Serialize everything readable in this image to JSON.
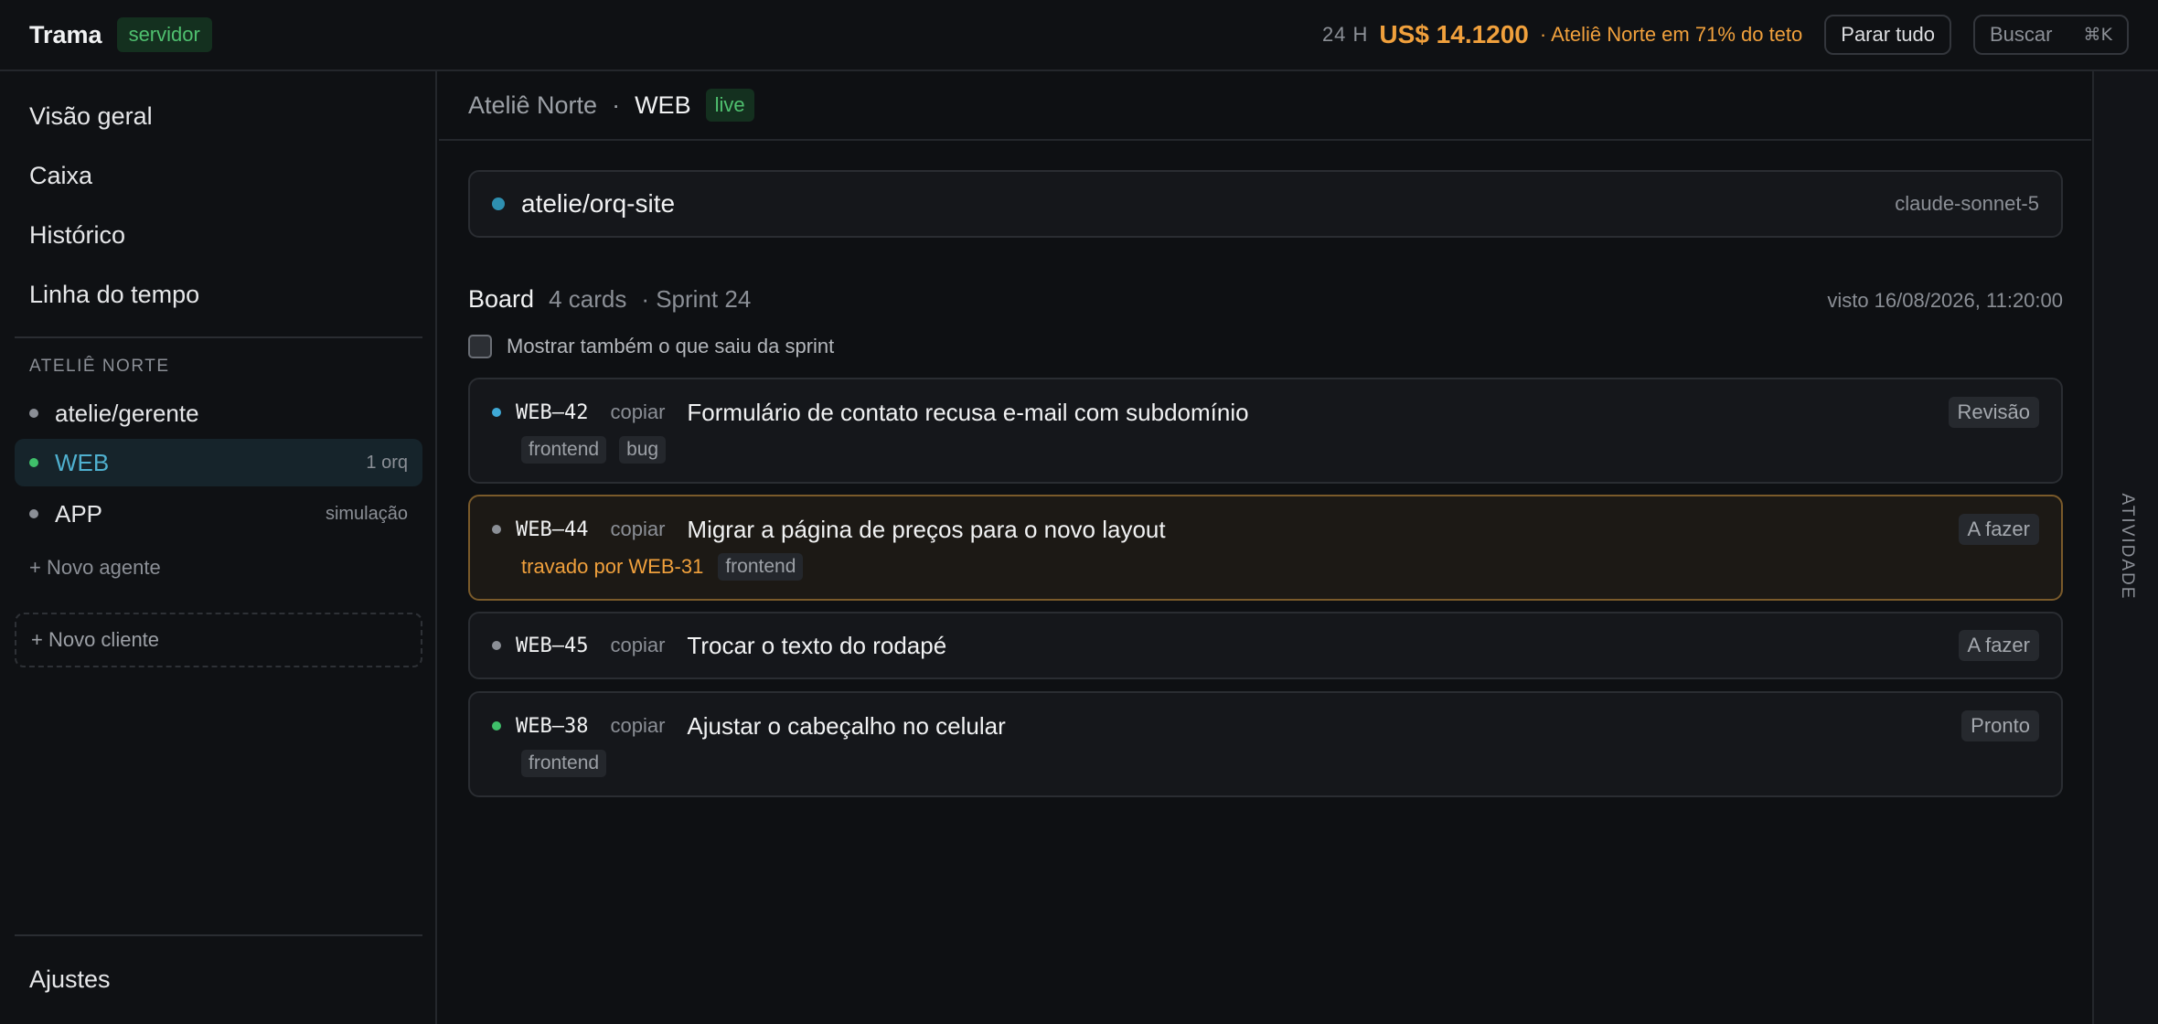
{
  "topbar": {
    "brand": "Trama",
    "env_badge": "servidor",
    "window_label": "24 H",
    "cost": "US$ 14.1200",
    "cost_note": "· Ateliê Norte em 71% do teto",
    "stop_all": "Parar tudo",
    "search_label": "Buscar",
    "search_shortcut": "⌘K"
  },
  "sidebar": {
    "nav": [
      "Visão geral",
      "Caixa",
      "Histórico",
      "Linha do tempo"
    ],
    "section_label": "ATELIÊ NORTE",
    "agents": [
      {
        "name": "atelie/gerente",
        "meta": "",
        "dot_color": "#8b8f96"
      },
      {
        "name": "WEB",
        "meta": "1 orq",
        "dot_color": "#3fbf6a"
      },
      {
        "name": "APP",
        "meta": "simulação",
        "dot_color": "#8b8f96"
      }
    ],
    "new_agent": "+ Novo agente",
    "new_client": "+ Novo cliente",
    "settings": "Ajustes"
  },
  "main": {
    "breadcrumb_client": "Ateliê Norte",
    "breadcrumb_sep": "·",
    "breadcrumb_current": "WEB",
    "live_badge": "live",
    "repo": {
      "name": "atelie/orq-site",
      "model": "claude-sonnet-5",
      "dot_color": "#2e8fb0"
    },
    "board": {
      "title": "Board",
      "count": "4 cards",
      "sprint": "· Sprint 24",
      "seen": "visto 16/08/2026, 11:20:00",
      "show_left_label": "Mostrar também o que saiu da sprint"
    },
    "cards": [
      {
        "id": "WEB–42",
        "copy": "copiar",
        "title": "Formulário de contato recusa e-mail com subdomínio",
        "status": "Revisão",
        "blocked_by": "",
        "tags": [
          "frontend",
          "bug"
        ],
        "dot_color": "#3fa9d6"
      },
      {
        "id": "WEB–44",
        "copy": "copiar",
        "title": "Migrar a página de preços para o novo layout",
        "status": "A fazer",
        "blocked_by": "travado por WEB-31",
        "tags": [
          "frontend"
        ],
        "dot_color": "#8b8f96"
      },
      {
        "id": "WEB–45",
        "copy": "copiar",
        "title": "Trocar o texto do rodapé",
        "status": "A fazer",
        "blocked_by": "",
        "tags": [],
        "dot_color": "#8b8f96"
      },
      {
        "id": "WEB–38",
        "copy": "copiar",
        "title": "Ajustar o cabeçalho no celular",
        "status": "Pronto",
        "blocked_by": "",
        "tags": [
          "frontend"
        ],
        "dot_color": "#3fbf6a"
      }
    ]
  },
  "activity": {
    "label": "ATIVIDADE"
  },
  "colors": {
    "accent": "#4fb0cf",
    "warning": "#f0a03c",
    "success": "#4fc06f"
  }
}
